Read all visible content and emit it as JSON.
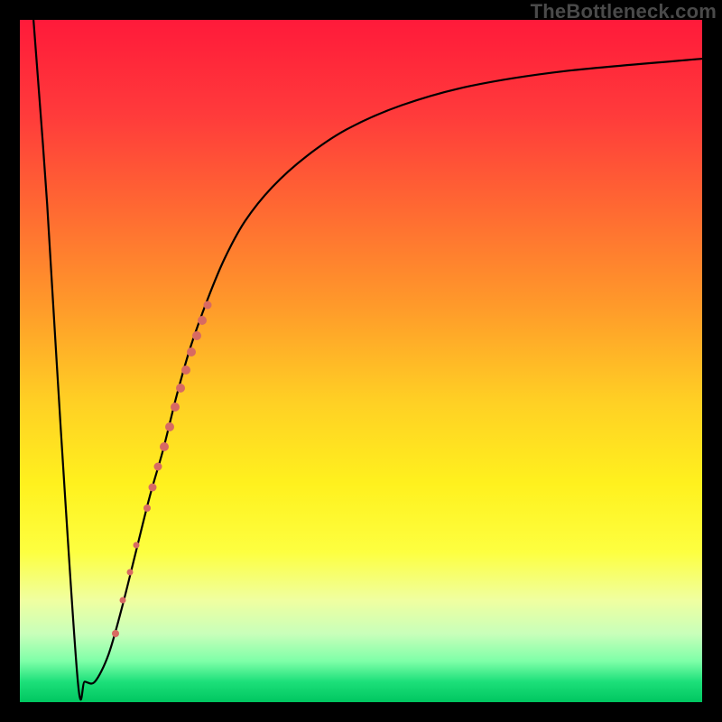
{
  "watermark": "TheBottleneck.com",
  "colors": {
    "marker": "#d86a62",
    "stroke": "#000000"
  },
  "chart_data": {
    "type": "line",
    "title": "",
    "xlabel": "",
    "ylabel": "",
    "xlim": [
      0,
      100
    ],
    "ylim": [
      0,
      100
    ],
    "grid": false,
    "legend": false,
    "series": [
      {
        "name": "bottleneck-curve",
        "x": [
          2,
          4,
          6,
          8.5,
          9.5,
          11,
          13,
          15,
          17,
          19,
          21,
          23,
          25,
          27.5,
          30,
          33,
          37,
          42,
          48,
          56,
          66,
          80,
          100
        ],
        "y": [
          100,
          73,
          40,
          3,
          3,
          3,
          7,
          14,
          22,
          30,
          37,
          45,
          52,
          59,
          65,
          70.5,
          75.5,
          80,
          84,
          87.5,
          90.3,
          92.5,
          94.3
        ]
      }
    ],
    "markers": [
      {
        "x": 14.0,
        "y": 10.0,
        "size": 8
      },
      {
        "x": 15.1,
        "y": 15.0,
        "size": 7
      },
      {
        "x": 16.2,
        "y": 19.0,
        "size": 7
      },
      {
        "x": 17.1,
        "y": 23.0,
        "size": 7
      },
      {
        "x": 18.7,
        "y": 28.5,
        "size": 8
      },
      {
        "x": 19.5,
        "y": 31.5,
        "size": 9
      },
      {
        "x": 20.3,
        "y": 34.5,
        "size": 9
      },
      {
        "x": 21.1,
        "y": 37.5,
        "size": 10
      },
      {
        "x": 21.9,
        "y": 40.3,
        "size": 10
      },
      {
        "x": 22.7,
        "y": 43.2,
        "size": 10
      },
      {
        "x": 23.5,
        "y": 46.0,
        "size": 10
      },
      {
        "x": 24.3,
        "y": 48.7,
        "size": 10
      },
      {
        "x": 25.1,
        "y": 51.3,
        "size": 10
      },
      {
        "x": 25.9,
        "y": 53.7,
        "size": 10
      },
      {
        "x": 26.7,
        "y": 56.0,
        "size": 10
      },
      {
        "x": 27.5,
        "y": 58.2,
        "size": 9
      }
    ]
  }
}
